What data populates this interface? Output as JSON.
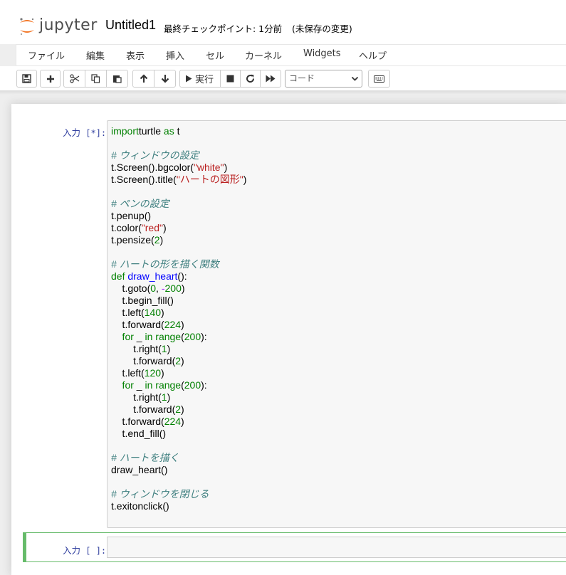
{
  "header": {
    "logo_text": "jupyter",
    "notebook_title": "Untitled1",
    "checkpoint": "最終チェックポイント: 1分前",
    "autosave": "(未保存の変更)"
  },
  "menubar": {
    "items": [
      "ファイル",
      "編集",
      "表示",
      "挿入",
      "セル",
      "カーネル",
      "Widgets",
      "ヘルプ"
    ]
  },
  "toolbar": {
    "run_label": "実行",
    "cell_type": "コード",
    "buttons": [
      "save-icon",
      "plus-icon",
      "scissors-icon",
      "copy-icon",
      "paste-icon",
      "arrow-up-icon",
      "arrow-down-icon",
      "play-icon",
      "stop-icon",
      "restart-icon",
      "fast-forward-icon",
      "keyboard-icon"
    ]
  },
  "cells": [
    {
      "prompt_label": "入力",
      "prompt_count": "[*]:",
      "code": [
        [
          [
            "kw",
            "import"
          ],
          [
            "",
            "turtle"
          ],
          [
            "kw",
            " as"
          ],
          [
            "",
            " t"
          ]
        ],
        [],
        [
          [
            "cmt",
            "# ウィンドウの設定"
          ]
        ],
        [
          [
            "",
            "t.Screen().bgcolor("
          ],
          [
            "str",
            "\"white\""
          ],
          [
            "",
            ")"
          ]
        ],
        [
          [
            "",
            "t.Screen().title("
          ],
          [
            "str",
            "\"ハートの図形\""
          ],
          [
            "",
            ")"
          ]
        ],
        [],
        [
          [
            "cmt",
            "# ペンの設定"
          ]
        ],
        [
          [
            "",
            "t.penup()"
          ]
        ],
        [
          [
            "",
            "t.color("
          ],
          [
            "str",
            "\"red\""
          ],
          [
            "",
            ")"
          ]
        ],
        [
          [
            "",
            "t.pensize("
          ],
          [
            "num",
            "2"
          ],
          [
            "",
            ")"
          ]
        ],
        [],
        [
          [
            "cmt",
            "# ハートの形を描く関数"
          ]
        ],
        [
          [
            "kw",
            "def"
          ],
          [
            "",
            " "
          ],
          [
            "fn",
            "draw_heart"
          ],
          [
            "",
            "():"
          ]
        ],
        [
          [
            "",
            "    t.goto("
          ],
          [
            "num",
            "0"
          ],
          [
            "",
            ", "
          ],
          [
            "op",
            "-"
          ],
          [
            "num",
            "200"
          ],
          [
            "",
            ")"
          ]
        ],
        [
          [
            "",
            "    t.begin_fill()"
          ]
        ],
        [
          [
            "",
            "    t.left("
          ],
          [
            "num",
            "140"
          ],
          [
            "",
            ")"
          ]
        ],
        [
          [
            "",
            "    t.forward("
          ],
          [
            "num",
            "224"
          ],
          [
            "",
            ")"
          ]
        ],
        [
          [
            "kw",
            "    for"
          ],
          [
            "",
            " _ "
          ],
          [
            "kw",
            "in"
          ],
          [
            "kw",
            " range"
          ],
          [
            "",
            "("
          ],
          [
            "num",
            "200"
          ],
          [
            "",
            "):"
          ]
        ],
        [
          [
            "",
            "        t.right("
          ],
          [
            "num",
            "1"
          ],
          [
            "",
            ")"
          ]
        ],
        [
          [
            "",
            "        t.forward("
          ],
          [
            "num",
            "2"
          ],
          [
            "",
            ")"
          ]
        ],
        [
          [
            "",
            "    t.left("
          ],
          [
            "num",
            "120"
          ],
          [
            "",
            ")"
          ]
        ],
        [
          [
            "kw",
            "    for"
          ],
          [
            "",
            " _ "
          ],
          [
            "kw",
            "in"
          ],
          [
            "kw",
            " range"
          ],
          [
            "",
            "("
          ],
          [
            "num",
            "200"
          ],
          [
            "",
            "):"
          ]
        ],
        [
          [
            "",
            "        t.right("
          ],
          [
            "num",
            "1"
          ],
          [
            "",
            ")"
          ]
        ],
        [
          [
            "",
            "        t.forward("
          ],
          [
            "num",
            "2"
          ],
          [
            "",
            ")"
          ]
        ],
        [
          [
            "",
            "    t.forward("
          ],
          [
            "num",
            "224"
          ],
          [
            "",
            ")"
          ]
        ],
        [
          [
            "",
            "    t.end_fill()"
          ]
        ],
        [],
        [
          [
            "cmt",
            "# ハートを描く"
          ]
        ],
        [
          [
            "",
            "draw_heart()"
          ]
        ],
        [],
        [
          [
            "cmt",
            "# ウィンドウを閉じる"
          ]
        ],
        [
          [
            "",
            "t.exitonclick()"
          ]
        ]
      ]
    },
    {
      "prompt_label": "入力",
      "prompt_count": "[ ]:",
      "code": []
    }
  ],
  "colors": {
    "prompt": "#303f9f",
    "keyword": "#008000",
    "string": "#ba2121",
    "comment": "#408080",
    "function": "#0000ff",
    "selected_cell_border": "#66bb6a",
    "logo_orange": "#f37726"
  }
}
